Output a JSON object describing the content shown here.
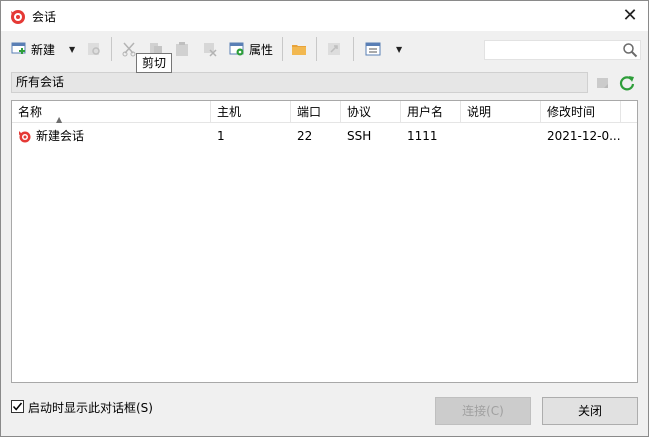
{
  "window": {
    "title": "会话",
    "close": "✕"
  },
  "toolbar": {
    "new_label": "新建",
    "properties_label": "属性",
    "tooltip": "剪切",
    "search_placeholder": ""
  },
  "path": {
    "text": "所有会话"
  },
  "list": {
    "columns": [
      "名称",
      "主机",
      "端口",
      "协议",
      "用户名",
      "说明",
      "修改时间"
    ],
    "rows": [
      [
        "新建会话",
        "1",
        "22",
        "SSH",
        "1111",
        "",
        "2021-12-0..."
      ]
    ]
  },
  "footer": {
    "checkbox_label": "启动时显示此对话框(S)",
    "checked": true,
    "connect_label": "连接(C)",
    "close_label": "关闭"
  },
  "colors": {
    "accent_red": "#e53935",
    "refresh_green": "#2e9e3a",
    "folder_orange": "#e8a33b"
  }
}
